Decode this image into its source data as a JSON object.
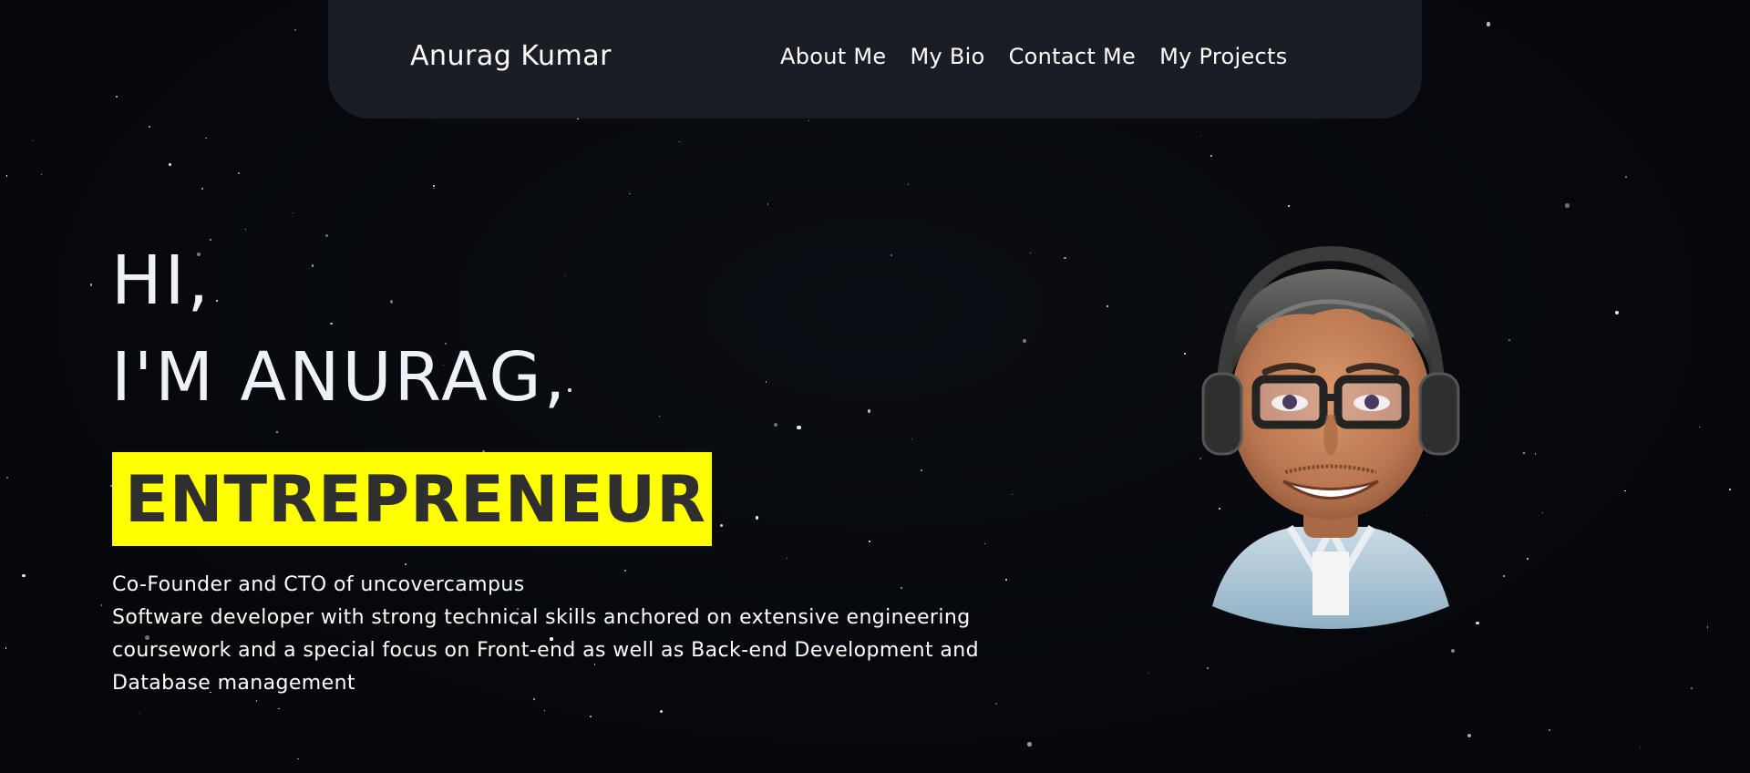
{
  "brand": "Anurag Kumar",
  "nav": {
    "items": [
      {
        "label": "About Me"
      },
      {
        "label": "My Bio"
      },
      {
        "label": "Contact Me"
      },
      {
        "label": "My Projects"
      }
    ]
  },
  "hero": {
    "greeting_line1": "HI,",
    "greeting_line2": "I'M ANURAG,",
    "role": "ENTREPRENEUR",
    "bio_line1": "Co-Founder and CTO of uncovercampus",
    "bio_line2": "Software developer with strong technical skills anchored on extensive engineering coursework and a special focus on Front-end as well as Back-end Development and Database management"
  },
  "colors": {
    "background": "#05070b",
    "navbar": "#1a1d24",
    "highlight": "#ffff00",
    "highlight_text": "#2f2f2f"
  },
  "avatar_icon": "memoji-avatar-with-headphones"
}
